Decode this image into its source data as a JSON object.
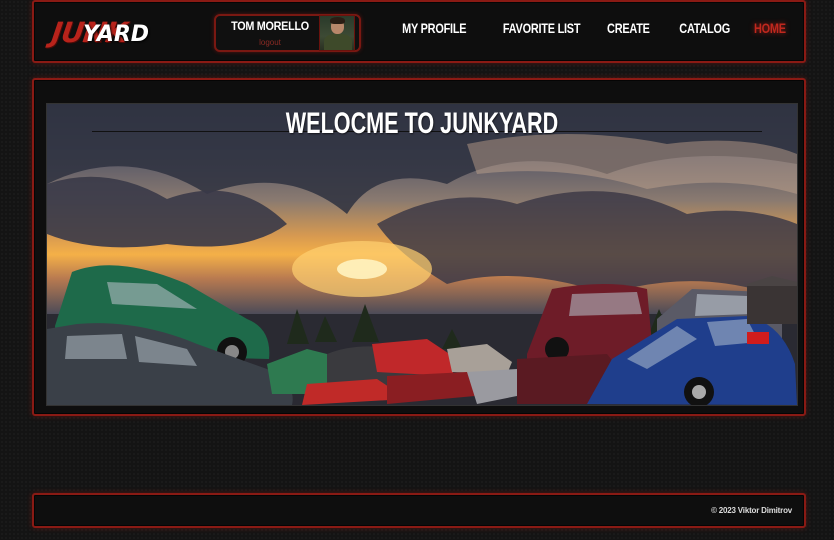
{
  "header": {
    "logo": {
      "part1": "JUNK",
      "part2": "YARD"
    },
    "user": {
      "name": "TOM MORELLO",
      "logout_label": "logout"
    },
    "nav": [
      {
        "label": "MY PROFILE",
        "active": false
      },
      {
        "label": "FAVORITE LIST",
        "active": false
      },
      {
        "label": "CREATE",
        "active": false
      },
      {
        "label": "CATALOG",
        "active": false
      },
      {
        "label": "HOME",
        "active": true
      }
    ]
  },
  "main": {
    "hero_title": "WELOCME TO JUNKYARD"
  },
  "footer": {
    "copyright": "© 2023 Viktor Dimitrov"
  },
  "colors": {
    "accent": "#b8231b",
    "border": "#8a1a14",
    "background": "#141414",
    "panel": "#0e0e0e"
  }
}
